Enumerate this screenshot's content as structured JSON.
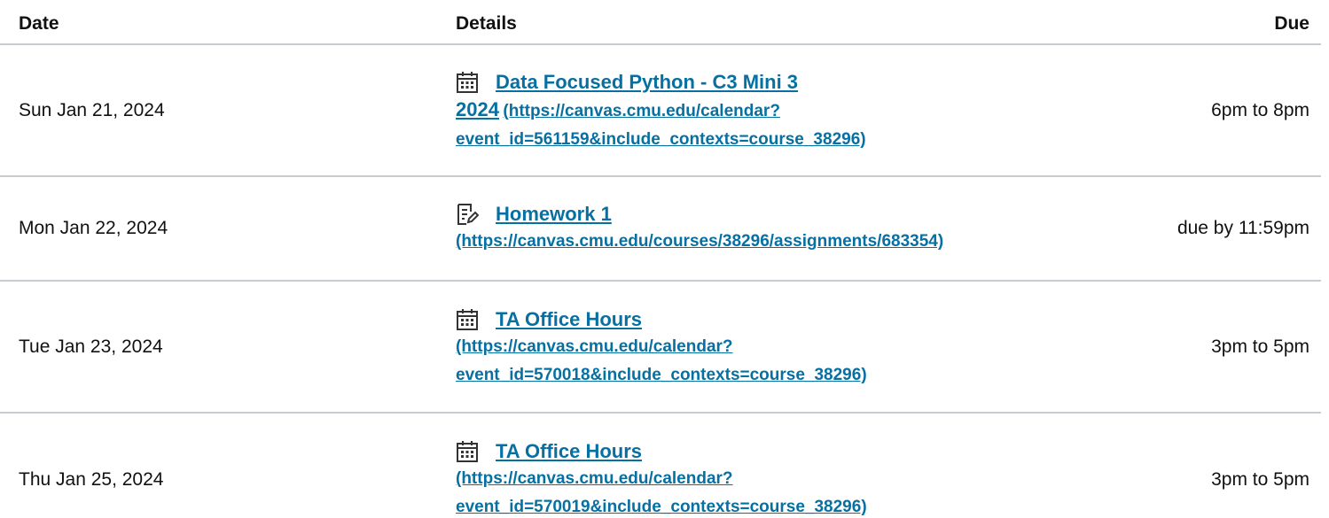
{
  "header": {
    "date": "Date",
    "details": "Details",
    "due": "Due"
  },
  "rows": [
    {
      "date": "Sun Jan 21, 2024",
      "icon": "calendar-icon",
      "title_line1": "Data Focused Python - C3 Mini 3",
      "title_line2": "2024",
      "url_part1": "(https://canvas.cmu.edu/calendar?",
      "url_part2": "event_id=561159&include_contexts=course_38296)",
      "due": "6pm to 8pm"
    },
    {
      "date": "Mon Jan 22, 2024",
      "icon": "assignment-icon",
      "title_line1": "Homework 1",
      "url_part1": "(https://canvas.cmu.edu/courses/38296/assignments/683354)",
      "due": "due by 11:59pm"
    },
    {
      "date": "Tue Jan 23, 2024",
      "icon": "calendar-icon",
      "title_line1": "TA Office Hours",
      "url_part1": "(https://canvas.cmu.edu/calendar?",
      "url_part2": "event_id=570018&include_contexts=course_38296)",
      "due": "3pm to 5pm"
    },
    {
      "date": "Thu Jan 25, 2024",
      "icon": "calendar-icon",
      "title_line1": "TA Office Hours",
      "url_part1": "(https://canvas.cmu.edu/calendar?",
      "url_part2": "event_id=570019&include_contexts=course_38296)",
      "due": "3pm to 5pm"
    }
  ],
  "colors": {
    "link": "#0770a3",
    "divider": "#c7cdd1"
  }
}
